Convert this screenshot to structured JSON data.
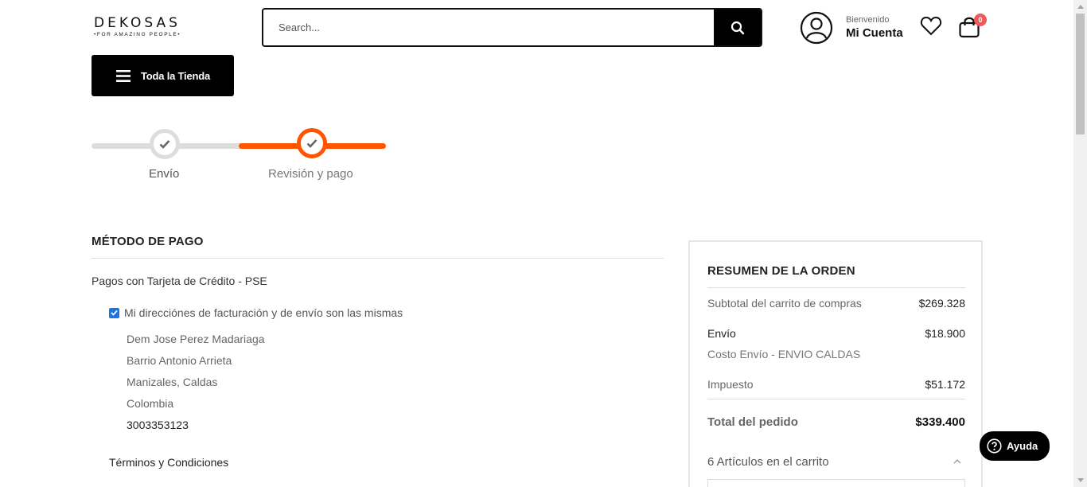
{
  "header": {
    "logo_main": "DEKOSAS",
    "logo_sub": "•FOR AMAZING PEOPLE•",
    "search_placeholder": "Search...",
    "welcome": "Bienvenido",
    "account": "Mi Cuenta",
    "cart_count": "0",
    "store_button": "Toda la Tienda"
  },
  "steps": [
    {
      "label": "Envío",
      "status": "completed"
    },
    {
      "label": "Revisión y pago",
      "status": "current"
    }
  ],
  "payment": {
    "title": "MÉTODO DE PAGO",
    "method": "Pagos con Tarjeta de Crédito - PSE",
    "same_address_label": "Mi direcciónes de facturación y de envío son las mismas",
    "same_address_checked": true,
    "address": {
      "name": "Dem Jose Perez Madariaga",
      "street": "Barrio Antonio Arrieta",
      "city": "Manizales, Caldas",
      "country": "Colombia",
      "phone": "3003353123"
    },
    "terms": "Términos y Condiciones"
  },
  "summary": {
    "title": "RESUMEN DE LA ORDEN",
    "subtotal_label": "Subtotal del carrito de compras",
    "subtotal_value": "$269.328",
    "shipping_label": "Envío",
    "shipping_value": "$18.900",
    "shipping_method": "Costo Envío - ENVIO CALDAS",
    "tax_label": "Impuesto",
    "tax_value": "$51.172",
    "total_label": "Total del pedido",
    "total_value": "$339.400",
    "items_label": "6 Artículos en el carrito"
  },
  "help": {
    "label": "Ayuda"
  },
  "colors": {
    "accent": "#ff5501",
    "primary": "#000000",
    "badge": "#ee5a5a"
  }
}
